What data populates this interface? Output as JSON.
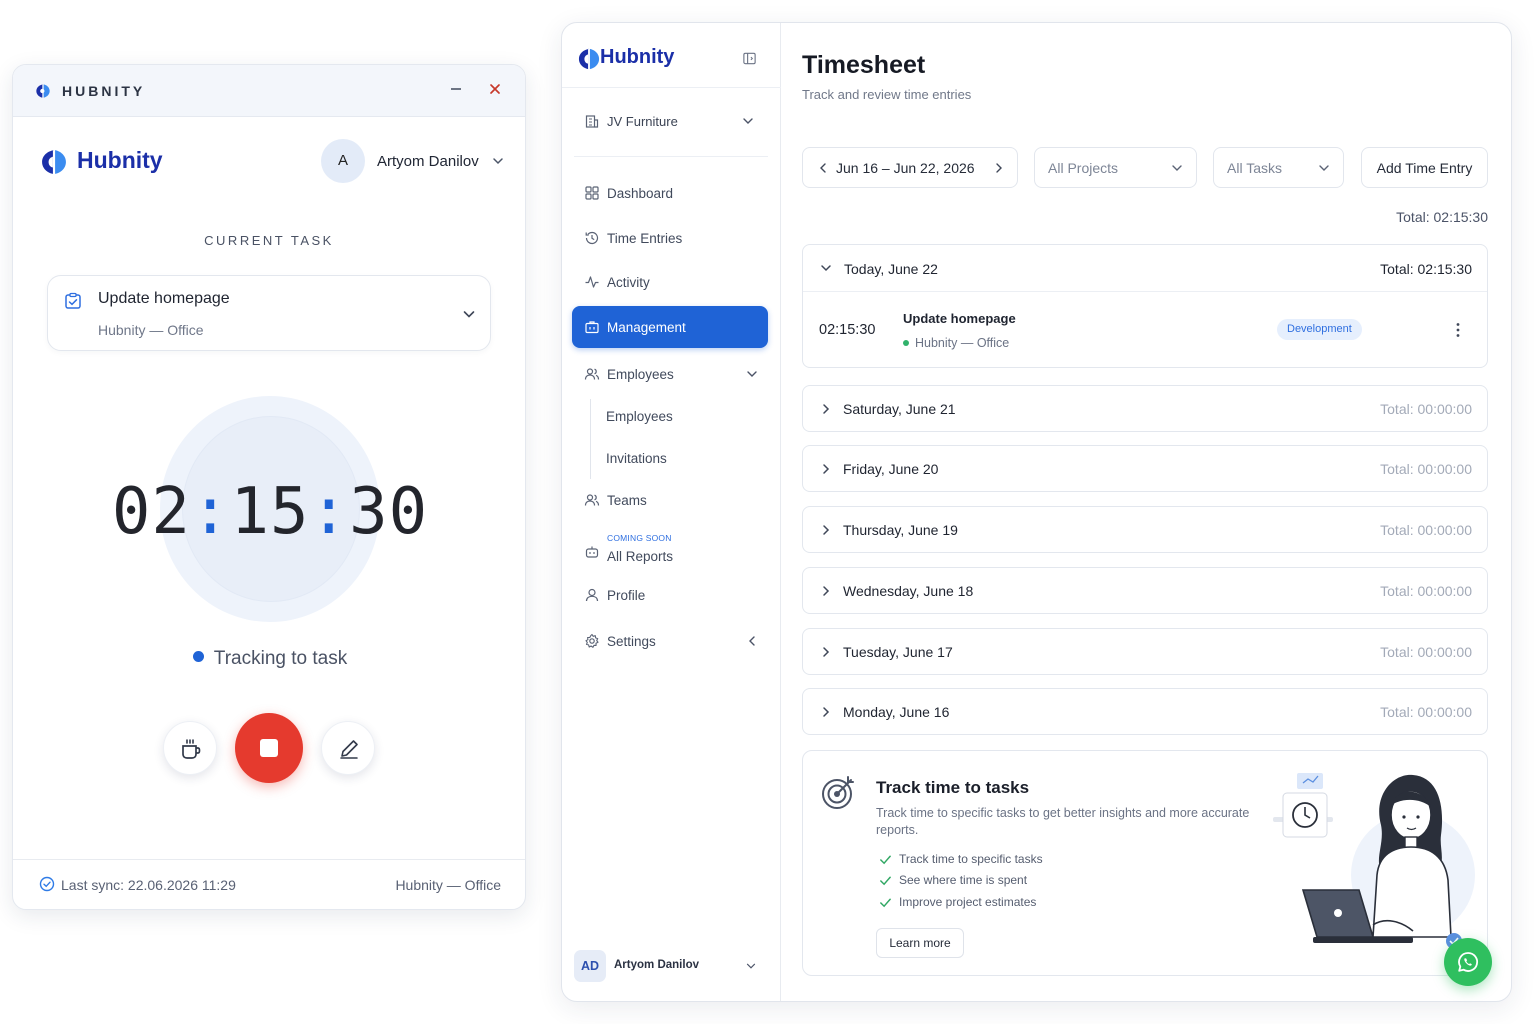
{
  "tracker": {
    "window_title": "HUBNITY",
    "brand": "Hubnity",
    "user": {
      "avatar": "A",
      "name": "Artyom Danilov"
    },
    "current_task_label": "CURRENT TASK",
    "task": {
      "title": "Update homepage",
      "subtitle": "Hubnity — Office"
    },
    "timer": {
      "hours": "02",
      "minutes": "15",
      "seconds": "30",
      "separator": ":"
    },
    "status": "Tracking to task",
    "footer": {
      "last_sync": "Last sync: 22.06.2026 11:29",
      "workspace": "Hubnity — Office"
    },
    "icons": [
      "minimize-icon",
      "close-icon",
      "clipboard-icon",
      "chevron-down-icon",
      "coffee-icon",
      "stop-icon",
      "pencil-icon",
      "check-circle-icon"
    ]
  },
  "app": {
    "brand": "Hubnity",
    "org": "JV Furniture",
    "nav": {
      "dashboard": "Dashboard",
      "time_entries": "Time Entries",
      "activity": "Activity",
      "management": "Management",
      "employees": "Employees",
      "employees_sub": "Employees",
      "invitations": "Invitations",
      "teams": "Teams",
      "coming_soon": "COMING SOON",
      "all_reports": "All Reports",
      "profile": "Profile",
      "settings": "Settings"
    },
    "user": {
      "initials": "AD",
      "name": "Artyom Danilov"
    },
    "page": {
      "title": "Timesheet",
      "subtitle": "Track and review time entries"
    },
    "filters": {
      "date_range": "Jun 16 – Jun 22, 2026",
      "projects": "All Projects",
      "tasks": "All Tasks",
      "add_button": "Add Time Entry"
    },
    "grand_total": "Total: 02:15:30",
    "today": {
      "label": "Today, June 22",
      "total": "Total: 02:15:30",
      "entry": {
        "duration": "02:15:30",
        "title": "Update homepage",
        "project": "Hubnity — Office",
        "tag": "Development"
      }
    },
    "days": [
      {
        "label": "Saturday, June 21",
        "total": "Total: 00:00:00"
      },
      {
        "label": "Friday, June 20",
        "total": "Total: 00:00:00"
      },
      {
        "label": "Thursday, June 19",
        "total": "Total: 00:00:00"
      },
      {
        "label": "Wednesday, June 18",
        "total": "Total: 00:00:00"
      },
      {
        "label": "Tuesday, June 17",
        "total": "Total: 00:00:00"
      },
      {
        "label": "Monday, June 16",
        "total": "Total: 00:00:00"
      }
    ],
    "promo": {
      "title": "Track time to tasks",
      "description": "Track time to specific tasks to get better insights and more accurate reports.",
      "items": [
        "Track time to specific tasks",
        "See where time is spent",
        "Improve project estimates"
      ],
      "button": "Learn more"
    }
  },
  "colors": {
    "brand_blue": "#1b2fa8",
    "accent": "#1f63d6",
    "stop_red": "#e53a2e",
    "success_green": "#2fbf5f"
  }
}
